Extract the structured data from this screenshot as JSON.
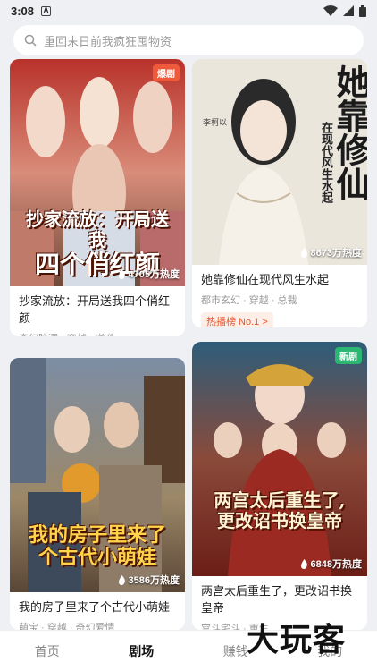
{
  "status_bar": {
    "time": "3:08",
    "notif_letter": "A"
  },
  "search": {
    "placeholder": "重回末日前我疯狂囤物资"
  },
  "cards": [
    {
      "poster_title_line1": "抄家流放：开局送我",
      "poster_title_line2": "四个俏红颜",
      "heat": "4705万热度",
      "badge": "爆剧",
      "title": "抄家流放：开局送我四个俏红颜",
      "tags": "奇幻脑洞 · 穿越 · 逆袭"
    },
    {
      "poster_title_big": "她靠修仙",
      "poster_title_vertical": "在现代风生水起",
      "poster_actor": "李柯以",
      "heat": "8673万热度",
      "title": "她靠修仙在现代风生水起",
      "tags": "都市玄幻 · 穿越 · 总裁",
      "rank": "热播榜 No.1 >"
    },
    {
      "poster_title_line1": "我的房子里来了",
      "poster_title_line2": "个古代小萌娃",
      "heat": "3586万热度",
      "title": "我的房子里来了个古代小萌娃",
      "tags": "萌宝 · 穿越 · 奇幻爱情"
    },
    {
      "poster_title_line1": "两宫太后重生了,",
      "poster_title_line2": "更改诏书换皇帝",
      "heat": "6848万热度",
      "badge": "新剧",
      "title": "两宫太后重生了，更改诏书换皇帝",
      "tags": "宫斗宅斗 · 重生"
    }
  ],
  "tabs": [
    {
      "label": "首页",
      "active": false
    },
    {
      "label": "剧场",
      "active": true
    },
    {
      "label": "赚钱",
      "active": false
    },
    {
      "label": "我的",
      "active": false
    }
  ],
  "watermark": "大玩客",
  "colors": {
    "accent": "#e8552d",
    "badge_hot": "#f05a3c",
    "badge_new": "#2bb673"
  }
}
